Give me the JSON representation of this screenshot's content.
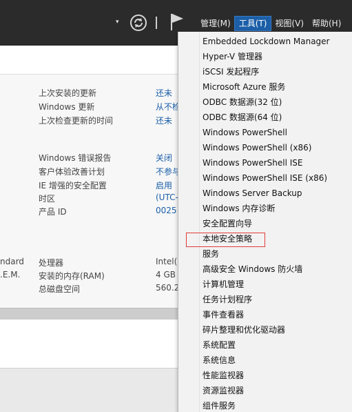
{
  "toolbar": {
    "dropdown_glyph": "▾",
    "menus": [
      {
        "label": "管理(M)"
      },
      {
        "label": "工具(T)",
        "active": true
      },
      {
        "label": "视图(V)"
      },
      {
        "label": "帮助(H)"
      }
    ]
  },
  "properties": {
    "update_group": [
      {
        "label": "上次安装的更新",
        "value": "还未"
      },
      {
        "label": "Windows 更新",
        "value": "从不检"
      },
      {
        "label": "上次检查更新的时间",
        "value": "还未"
      }
    ],
    "report_group": [
      {
        "label": "Windows 错误报告",
        "value": "关闭"
      },
      {
        "label": "客户体验改善计划",
        "value": "不参与"
      },
      {
        "label": "IE 增强的安全配置",
        "value": "启用"
      },
      {
        "label": "时区",
        "value": "(UTC-"
      },
      {
        "label": "产品 ID",
        "value": "0025"
      }
    ],
    "hardware_group": [
      {
        "left": "ndard",
        "label": "处理器",
        "value": "Intel("
      },
      {
        "left": ".E.M.",
        "label": "安装的内存(RAM)",
        "value": "4 GB"
      },
      {
        "left": "",
        "label": "总磁盘空间",
        "value": "560.2"
      }
    ]
  },
  "tools_menu": {
    "items": [
      "Embedded Lockdown Manager",
      "Hyper-V 管理器",
      "iSCSI 发起程序",
      "Microsoft Azure 服务",
      "ODBC 数据源(32 位)",
      "ODBC 数据源(64 位)",
      "Windows PowerShell",
      "Windows PowerShell (x86)",
      "Windows PowerShell ISE",
      "Windows PowerShell ISE (x86)",
      "Windows Server Backup",
      "Windows 内存诊断",
      "安全配置向导",
      "本地安全策略",
      "服务",
      "高级安全 Windows 防火墙",
      "计算机管理",
      "任务计划程序",
      "事件查看器",
      "碎片整理和优化驱动器",
      "系统配置",
      "系统信息",
      "性能监视器",
      "资源监视器",
      "组件服务"
    ],
    "highlighted": "本地安全策略"
  },
  "colors": {
    "topbar": "#2b2b2b",
    "menu_active": "#1c5fa8",
    "link": "#1a5ea8",
    "highlight_border": "#e03a3a"
  }
}
